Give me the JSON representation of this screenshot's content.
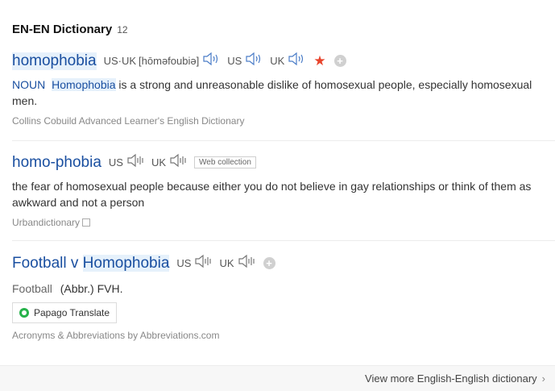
{
  "header": {
    "title": "EN-EN Dictionary",
    "count": "12"
  },
  "entries": [
    {
      "word": "homophobia",
      "pron_label": "US·UK",
      "phonetic": "[hōməfoubiə]",
      "us": "US",
      "uk": "UK",
      "pos": "NOUN",
      "def_highlight": "Homophobia",
      "def_rest": " is a strong and unreasonable dislike of homosexual people, especially homosexual men.",
      "source": "Collins Cobuild Advanced Learner's English Dictionary"
    },
    {
      "word": "homo-phobia",
      "us": "US",
      "uk": "UK",
      "badge": "Web collection",
      "definition": "the fear of homosexual people because either you do not believe in gay relationships or think of them as awkward and not a person",
      "source": "Urbandictionary"
    },
    {
      "word_part1": "Football v ",
      "word_part2": "Homophobia",
      "us": "US",
      "uk": "UK",
      "abbr_word": "Football",
      "abbr_value": "(Abbr.) FVH.",
      "papago": "Papago Translate",
      "source": "Acronyms & Abbreviations by Abbreviations.com"
    }
  ],
  "footer": {
    "more": "View more English-English dictionary"
  },
  "icons": [
    "speaker-icon",
    "star-icon",
    "plus-icon",
    "external-link-icon",
    "papago-icon",
    "chevron-right-icon"
  ],
  "colors": {
    "link": "#1a4fa0",
    "star": "#e8442c",
    "highlight": "#e6f1fb"
  }
}
